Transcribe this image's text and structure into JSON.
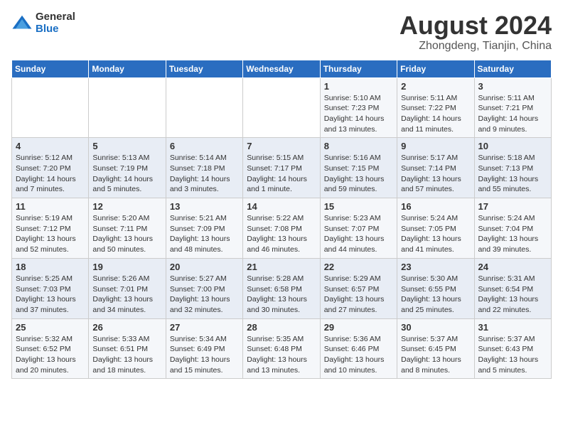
{
  "logo": {
    "general": "General",
    "blue": "Blue"
  },
  "title": "August 2024",
  "subtitle": "Zhongdeng, Tianjin, China",
  "weekdays": [
    "Sunday",
    "Monday",
    "Tuesday",
    "Wednesday",
    "Thursday",
    "Friday",
    "Saturday"
  ],
  "weeks": [
    [
      {
        "day": "",
        "info": ""
      },
      {
        "day": "",
        "info": ""
      },
      {
        "day": "",
        "info": ""
      },
      {
        "day": "",
        "info": ""
      },
      {
        "day": "1",
        "info": "Sunrise: 5:10 AM\nSunset: 7:23 PM\nDaylight: 14 hours\nand 13 minutes."
      },
      {
        "day": "2",
        "info": "Sunrise: 5:11 AM\nSunset: 7:22 PM\nDaylight: 14 hours\nand 11 minutes."
      },
      {
        "day": "3",
        "info": "Sunrise: 5:11 AM\nSunset: 7:21 PM\nDaylight: 14 hours\nand 9 minutes."
      }
    ],
    [
      {
        "day": "4",
        "info": "Sunrise: 5:12 AM\nSunset: 7:20 PM\nDaylight: 14 hours\nand 7 minutes."
      },
      {
        "day": "5",
        "info": "Sunrise: 5:13 AM\nSunset: 7:19 PM\nDaylight: 14 hours\nand 5 minutes."
      },
      {
        "day": "6",
        "info": "Sunrise: 5:14 AM\nSunset: 7:18 PM\nDaylight: 14 hours\nand 3 minutes."
      },
      {
        "day": "7",
        "info": "Sunrise: 5:15 AM\nSunset: 7:17 PM\nDaylight: 14 hours\nand 1 minute."
      },
      {
        "day": "8",
        "info": "Sunrise: 5:16 AM\nSunset: 7:15 PM\nDaylight: 13 hours\nand 59 minutes."
      },
      {
        "day": "9",
        "info": "Sunrise: 5:17 AM\nSunset: 7:14 PM\nDaylight: 13 hours\nand 57 minutes."
      },
      {
        "day": "10",
        "info": "Sunrise: 5:18 AM\nSunset: 7:13 PM\nDaylight: 13 hours\nand 55 minutes."
      }
    ],
    [
      {
        "day": "11",
        "info": "Sunrise: 5:19 AM\nSunset: 7:12 PM\nDaylight: 13 hours\nand 52 minutes."
      },
      {
        "day": "12",
        "info": "Sunrise: 5:20 AM\nSunset: 7:11 PM\nDaylight: 13 hours\nand 50 minutes."
      },
      {
        "day": "13",
        "info": "Sunrise: 5:21 AM\nSunset: 7:09 PM\nDaylight: 13 hours\nand 48 minutes."
      },
      {
        "day": "14",
        "info": "Sunrise: 5:22 AM\nSunset: 7:08 PM\nDaylight: 13 hours\nand 46 minutes."
      },
      {
        "day": "15",
        "info": "Sunrise: 5:23 AM\nSunset: 7:07 PM\nDaylight: 13 hours\nand 44 minutes."
      },
      {
        "day": "16",
        "info": "Sunrise: 5:24 AM\nSunset: 7:05 PM\nDaylight: 13 hours\nand 41 minutes."
      },
      {
        "day": "17",
        "info": "Sunrise: 5:24 AM\nSunset: 7:04 PM\nDaylight: 13 hours\nand 39 minutes."
      }
    ],
    [
      {
        "day": "18",
        "info": "Sunrise: 5:25 AM\nSunset: 7:03 PM\nDaylight: 13 hours\nand 37 minutes."
      },
      {
        "day": "19",
        "info": "Sunrise: 5:26 AM\nSunset: 7:01 PM\nDaylight: 13 hours\nand 34 minutes."
      },
      {
        "day": "20",
        "info": "Sunrise: 5:27 AM\nSunset: 7:00 PM\nDaylight: 13 hours\nand 32 minutes."
      },
      {
        "day": "21",
        "info": "Sunrise: 5:28 AM\nSunset: 6:58 PM\nDaylight: 13 hours\nand 30 minutes."
      },
      {
        "day": "22",
        "info": "Sunrise: 5:29 AM\nSunset: 6:57 PM\nDaylight: 13 hours\nand 27 minutes."
      },
      {
        "day": "23",
        "info": "Sunrise: 5:30 AM\nSunset: 6:55 PM\nDaylight: 13 hours\nand 25 minutes."
      },
      {
        "day": "24",
        "info": "Sunrise: 5:31 AM\nSunset: 6:54 PM\nDaylight: 13 hours\nand 22 minutes."
      }
    ],
    [
      {
        "day": "25",
        "info": "Sunrise: 5:32 AM\nSunset: 6:52 PM\nDaylight: 13 hours\nand 20 minutes."
      },
      {
        "day": "26",
        "info": "Sunrise: 5:33 AM\nSunset: 6:51 PM\nDaylight: 13 hours\nand 18 minutes."
      },
      {
        "day": "27",
        "info": "Sunrise: 5:34 AM\nSunset: 6:49 PM\nDaylight: 13 hours\nand 15 minutes."
      },
      {
        "day": "28",
        "info": "Sunrise: 5:35 AM\nSunset: 6:48 PM\nDaylight: 13 hours\nand 13 minutes."
      },
      {
        "day": "29",
        "info": "Sunrise: 5:36 AM\nSunset: 6:46 PM\nDaylight: 13 hours\nand 10 minutes."
      },
      {
        "day": "30",
        "info": "Sunrise: 5:37 AM\nSunset: 6:45 PM\nDaylight: 13 hours\nand 8 minutes."
      },
      {
        "day": "31",
        "info": "Sunrise: 5:37 AM\nSunset: 6:43 PM\nDaylight: 13 hours\nand 5 minutes."
      }
    ]
  ]
}
